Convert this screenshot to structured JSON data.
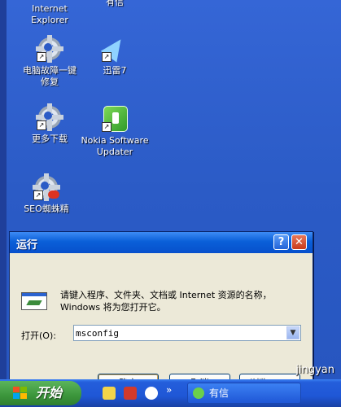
{
  "desktop": {
    "icons": [
      {
        "label": "Internet\nExplorer"
      },
      {
        "label": "有信"
      },
      {
        "label": "电脑故障一键\n修复"
      },
      {
        "label": "迅雷7"
      },
      {
        "label": "更多下载"
      },
      {
        "label": "Nokia Software\nUpdater"
      },
      {
        "label": "SEO蜘蛛精"
      }
    ]
  },
  "dialog": {
    "title": "运行",
    "help_glyph": "?",
    "close_glyph": "✕",
    "prompt": "请键入程序、文件夹、文档或 Internet 资源的名称，Windows 将为您打开它。",
    "open_label": "打开(O):",
    "open_value": "msconfig",
    "ok_label": "确定",
    "cancel_label": "取消",
    "browse_label": "浏览(B)..."
  },
  "taskbar": {
    "start_label": "开始",
    "more_glyph": "»",
    "task_label": "有信"
  },
  "watermark": "jingyan"
}
